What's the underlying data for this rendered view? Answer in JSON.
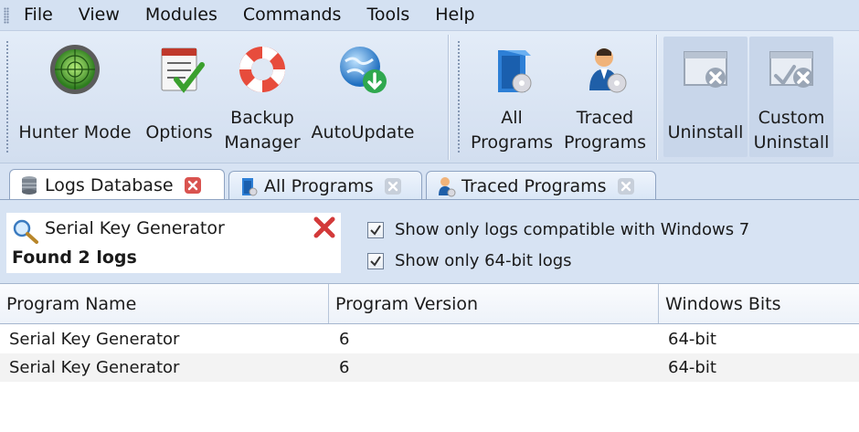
{
  "menu": {
    "items": [
      "File",
      "View",
      "Modules",
      "Commands",
      "Tools",
      "Help"
    ]
  },
  "toolbar": {
    "hunter_mode": {
      "label": "Hunter Mode",
      "icon": "radar-icon"
    },
    "options": {
      "label": "Options",
      "icon": "checklist-icon"
    },
    "backup_manager": {
      "label_line1": "Backup",
      "label_line2": "Manager",
      "icon": "lifebuoy-icon"
    },
    "autoupdate": {
      "label": "AutoUpdate",
      "icon": "globe-download-icon"
    },
    "all_programs": {
      "label_line1": "All",
      "label_line2": "Programs",
      "icon": "program-box-icon"
    },
    "traced_programs": {
      "label_line1": "Traced",
      "label_line2": "Programs",
      "icon": "user-cd-icon"
    },
    "uninstall": {
      "label": "Uninstall",
      "icon": "window-remove-icon"
    },
    "custom_uninstall": {
      "label_line1": "Custom",
      "label_line2": "Uninstall",
      "icon": "window-check-remove-icon"
    }
  },
  "tabs": [
    {
      "label": "Logs Database",
      "active": true,
      "icon": "database-icon"
    },
    {
      "label": "All Programs",
      "active": false,
      "icon": "program-box-icon"
    },
    {
      "label": "Traced Programs",
      "active": false,
      "icon": "user-cd-icon"
    }
  ],
  "search": {
    "query": "Serial Key Generator",
    "result_text": "Found 2 logs"
  },
  "filters": {
    "compat_label": "Show only logs compatible with Windows 7",
    "compat_checked": true,
    "bits_label": "Show only 64-bit logs",
    "bits_checked": true
  },
  "table": {
    "columns": [
      "Program Name",
      "Program Version",
      "Windows Bits"
    ],
    "rows": [
      [
        "Serial Key Generator",
        "6",
        "64-bit"
      ],
      [
        "Serial Key Generator",
        "6",
        "64-bit"
      ]
    ]
  },
  "colors": {
    "menubar_bg": "#d4e1f2",
    "toolbar_bg": "#d9e4f3",
    "close_red": "#d33a3a"
  }
}
